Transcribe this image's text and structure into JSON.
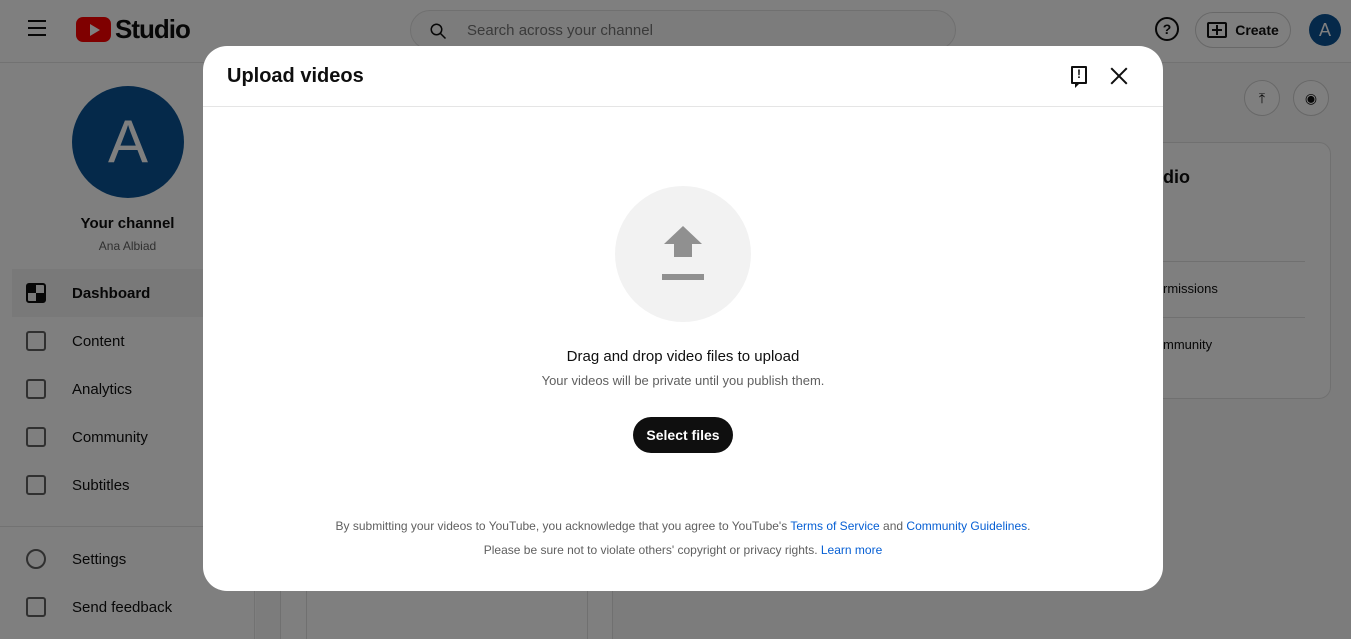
{
  "app": {
    "logo_text": "Studio",
    "search_placeholder": "Search across your channel",
    "help_glyph": "?",
    "create_label": "Create",
    "avatar_letter": "A"
  },
  "sidebar": {
    "channel_avatar_letter": "A",
    "channel_title": "Your channel",
    "channel_name": "Ana Albiad",
    "items": [
      {
        "label": "Dashboard",
        "active": true
      },
      {
        "label": "Content"
      },
      {
        "label": "Analytics"
      },
      {
        "label": "Community"
      },
      {
        "label": "Subtitles"
      }
    ],
    "bottom_items": [
      {
        "label": "Settings"
      },
      {
        "label": "Send feedback"
      }
    ]
  },
  "background": {
    "card_title_fragment": "dio",
    "row1_fragment": "rmissions",
    "row2_fragment": "mmunity"
  },
  "dialog": {
    "title": "Upload videos",
    "feedback_glyph": "!",
    "drag_title": "Drag and drop video files to upload",
    "drag_subtitle": "Your videos will be private until you publish them.",
    "select_button": "Select files",
    "legal_line1_prefix": "By submitting your videos to YouTube, you acknowledge that you agree to YouTube's ",
    "terms_link": "Terms of Service",
    "legal_line1_mid": " and ",
    "guidelines_link": "Community Guidelines",
    "legal_line1_suffix": ".",
    "legal_line2_prefix": "Please be sure not to violate others' copyright or privacy rights. ",
    "learn_more_link": "Learn more"
  },
  "colors": {
    "brand_red": "#ff0000",
    "avatar_blue": "#0b5394",
    "link_blue": "#065fd4",
    "overlay": "rgba(0,0,0,0.5)"
  }
}
